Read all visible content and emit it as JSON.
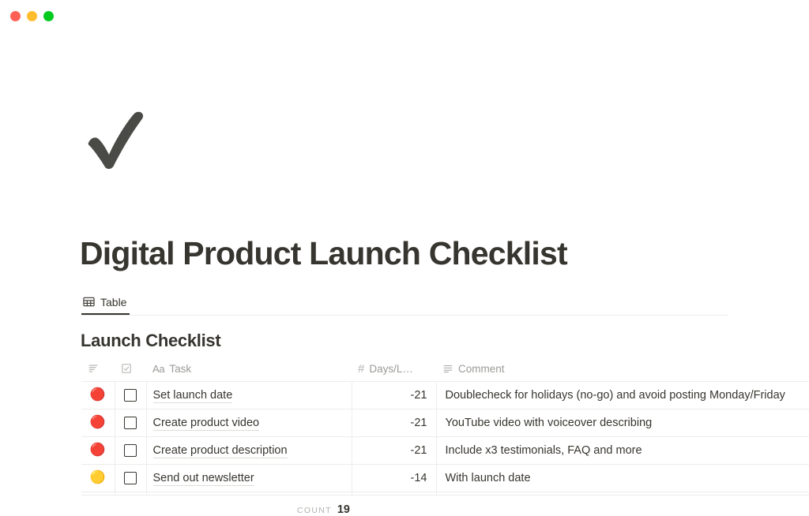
{
  "window": {
    "controls": [
      {
        "name": "close",
        "color": "#ff5f57"
      },
      {
        "name": "minimize",
        "color": "#ffbd2e"
      },
      {
        "name": "maximize",
        "color": "#00ca1e"
      }
    ]
  },
  "page": {
    "icon": "heavy-check-mark-icon",
    "title": "Digital Product Launch Checklist"
  },
  "views": {
    "tabs": [
      {
        "label": "Table",
        "icon": "table-grid-icon",
        "active": true
      }
    ]
  },
  "database": {
    "title": "Launch Checklist",
    "columns": [
      {
        "key": "status",
        "label": "",
        "icon": "multi-select-lines-icon",
        "type": "select"
      },
      {
        "key": "done",
        "label": "",
        "icon": "checkbox-icon",
        "type": "checkbox"
      },
      {
        "key": "task",
        "label": "Task",
        "icon": "aa-text-icon",
        "type": "title"
      },
      {
        "key": "days",
        "label": "Days/L…",
        "icon": "hash-number-icon",
        "type": "number"
      },
      {
        "key": "comment",
        "label": "Comment",
        "icon": "text-lines-icon",
        "type": "text"
      }
    ],
    "rows": [
      {
        "status": "🔴",
        "status_color": "#c0392b",
        "done": false,
        "task": "Set launch date",
        "days": "-21",
        "comment": "Doublecheck for holidays (no-go) and avoid posting Monday/Friday"
      },
      {
        "status": "🔴",
        "status_color": "#c0392b",
        "done": false,
        "task": "Create product video",
        "days": "-21",
        "comment": "YouTube video with voiceover describing"
      },
      {
        "status": "🔴",
        "status_color": "#c0392b",
        "done": false,
        "task": "Create product description",
        "days": "-21",
        "comment": "Include x3 testimonials, FAQ and more"
      },
      {
        "status": "🟡",
        "status_color": "#f5d544",
        "done": false,
        "task": "Send out newsletter",
        "days": "-14",
        "comment": "With launch date"
      }
    ],
    "footer": {
      "count_label": "Count",
      "count_value": "19"
    }
  },
  "colors": {
    "text": "#37352f",
    "muted": "#9b9a97",
    "border": "#ececeb",
    "background": "#ffffff"
  }
}
